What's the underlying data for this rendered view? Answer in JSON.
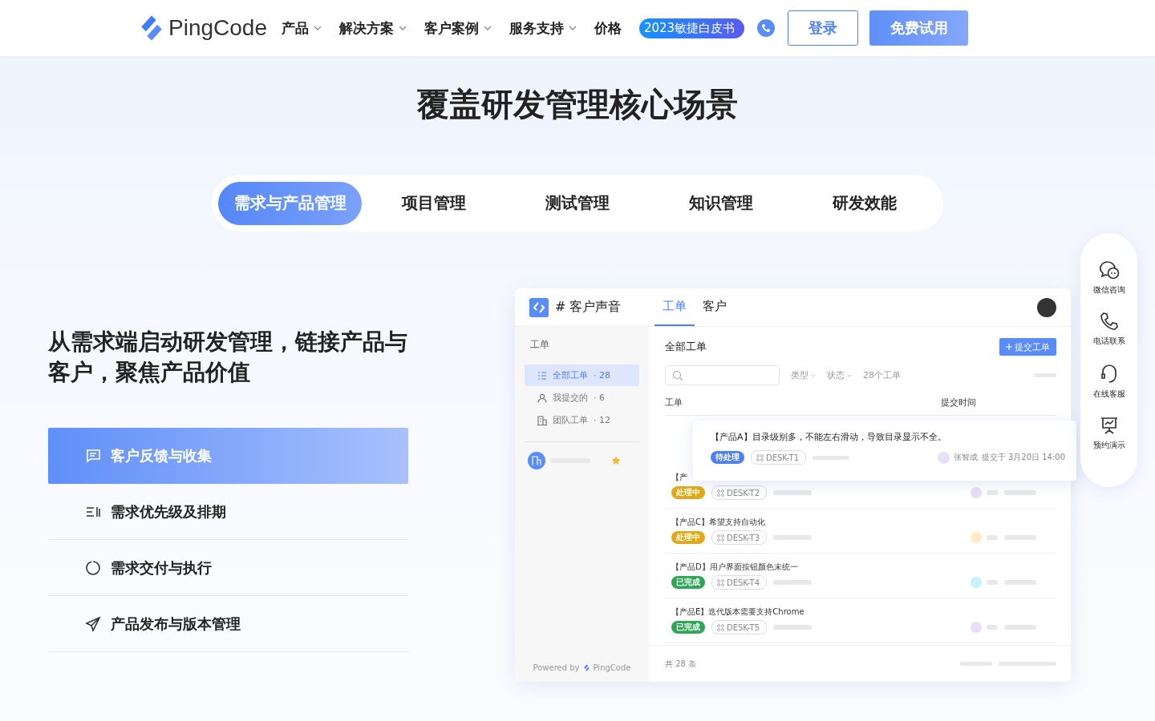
{
  "nav": {
    "logo": "PingCode",
    "menu": [
      {
        "label": "产品",
        "has_caret": true
      },
      {
        "label": "解决方案",
        "has_caret": true
      },
      {
        "label": "客户案例",
        "has_caret": true
      },
      {
        "label": "服务支持",
        "has_caret": true
      },
      {
        "label": "价格",
        "has_caret": false
      }
    ],
    "promo": "2023敏捷白皮书",
    "login": "登录",
    "trial": "免费试用"
  },
  "hero_title": "覆盖研发管理核心场景",
  "tabs": [
    {
      "label": "需求与产品管理",
      "selected": true
    },
    {
      "label": "项目管理",
      "selected": false
    },
    {
      "label": "测试管理",
      "selected": false
    },
    {
      "label": "知识管理",
      "selected": false
    },
    {
      "label": "研发效能",
      "selected": false
    }
  ],
  "section_heading": "从需求端启动研发管理，链接产品与客户，聚焦产品价值",
  "features": [
    {
      "label": "客户反馈与收集",
      "selected": true
    },
    {
      "label": "需求优先级及排期",
      "selected": false
    },
    {
      "label": "需求交付与执行",
      "selected": false
    },
    {
      "label": "产品发布与版本管理",
      "selected": false
    }
  ],
  "app": {
    "title": "# 客户声音",
    "tabs": [
      {
        "label": "工单",
        "selected": true
      },
      {
        "label": "客户",
        "selected": false
      }
    ],
    "sidebar": {
      "heading": "工单",
      "items": [
        {
          "label": "全部工单",
          "count": "· 28",
          "selected": true
        },
        {
          "label": "我提交的",
          "count": "· 6",
          "selected": false
        },
        {
          "label": "团队工单",
          "count": "· 12",
          "selected": false
        }
      ],
      "powered_by": "Powered by",
      "brand": "PingCode"
    },
    "main_title": "全部工单",
    "submit_button": "提交工单",
    "filters": [
      {
        "label": "类型",
        "has_caret": true
      },
      {
        "label": "状态",
        "has_caret": true
      },
      {
        "label": "28个工单",
        "has_caret": false
      }
    ],
    "columns": [
      "工单",
      "提交时间"
    ],
    "popup": {
      "title": "【产品A】目录级别多，不能左右滑动，导致目录显示不全。",
      "status": "待处理",
      "id": "DESK-T1",
      "user": "张智成",
      "time": "提交于 3月20日 14:00"
    },
    "rows": [
      {
        "title": "【产",
        "status": "处理中",
        "kind": "processing",
        "id": "DESK-T2",
        "color": "#eadcfb"
      },
      {
        "title": "【产品C】希望支持自动化",
        "status": "处理中",
        "kind": "processing",
        "id": "DESK-T3",
        "color": "#fcebc4"
      },
      {
        "title": "【产品D】用户界面按钮颜色未统一",
        "status": "已完成",
        "kind": "done",
        "id": "DESK-T4",
        "color": "#c9f1f9"
      },
      {
        "title": "【产品E】迭代版本需要支持Chrome",
        "status": "已完成",
        "kind": "done",
        "id": "DESK-T5",
        "color": "#eadcfb"
      }
    ],
    "footer": "共 28 条"
  },
  "side_panel": [
    {
      "label": "微信咨询"
    },
    {
      "label": "电话联系"
    },
    {
      "label": "在线客服"
    },
    {
      "label": "预约演示"
    }
  ]
}
